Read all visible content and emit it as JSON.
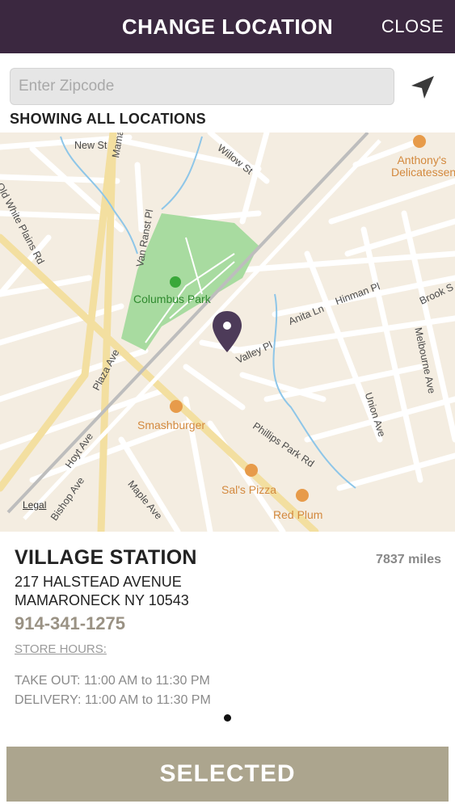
{
  "header": {
    "title": "CHANGE LOCATION",
    "close_label": "CLOSE"
  },
  "search": {
    "placeholder": "Enter Zipcode",
    "value": ""
  },
  "filter_label": "SHOWING ALL LOCATIONS",
  "map": {
    "streets": [
      "New St",
      "Mamaroneck",
      "Willow St",
      "Old White Plains Rd",
      "Van Ranst Pl",
      "Hinman Pl",
      "Anita Ln",
      "Brook S",
      "Valley Pl",
      "Melbourne Ave",
      "Plaza Ave",
      "Union Ave",
      "Hoyt Ave",
      "Phillips Park Rd",
      "Bishop Ave",
      "Maple Ave"
    ],
    "pois": [
      "Anthony's Delicatessen",
      "Smashburger",
      "Sal's Pizza",
      "Red Plum"
    ],
    "park": "Columbus Park",
    "legal": "Legal"
  },
  "store": {
    "name": "VILLAGE STATION",
    "distance": "7837 miles",
    "address_line1": "217 HALSTEAD AVENUE",
    "address_line2": "MAMARONECK NY 10543",
    "phone": "914-341-1275",
    "hours_link": "STORE HOURS:",
    "take_out": "TAKE OUT: 11:00 AM to 11:30 PM",
    "delivery": "DELIVERY: 11:00 AM to 11:30 PM"
  },
  "button": {
    "selected_label": "SELECTED"
  },
  "colors": {
    "header": "#3b2840",
    "button": "#aca58e",
    "pin": "#4d3b59",
    "park": "#a8dba0",
    "map_bg": "#f4ede1"
  }
}
